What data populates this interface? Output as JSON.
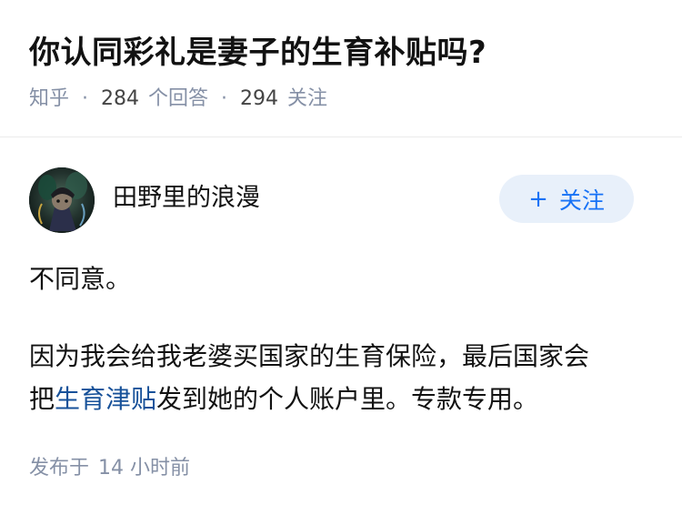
{
  "question": {
    "title": "你认同彩礼是妻子的生育补贴吗?",
    "source": "知乎",
    "answer_count": "284",
    "answer_label": "个回答",
    "follower_count": "294",
    "follower_label": "关注",
    "separator": "·"
  },
  "author": {
    "name": "田野里的浪漫",
    "avatar_icon": "avatar-image",
    "follow_plus": "+",
    "follow_label": "关注"
  },
  "answer": {
    "paragraph1": "不同意。",
    "p2_line1": "因为我会给我老婆买国家的生育保险，最后国家会",
    "p2_line2_prefix": "把",
    "p2_link": "生育津贴",
    "p2_line2_suffix": "发到她的个人账户里。专款专用。"
  },
  "footer": {
    "posted_prefix": "发布于",
    "posted_value": "14 小时前"
  },
  "colors": {
    "link": "#175199",
    "follow_bg": "#e8f0fa",
    "follow_text": "#1772f6",
    "meta_gray": "#8590a6"
  }
}
